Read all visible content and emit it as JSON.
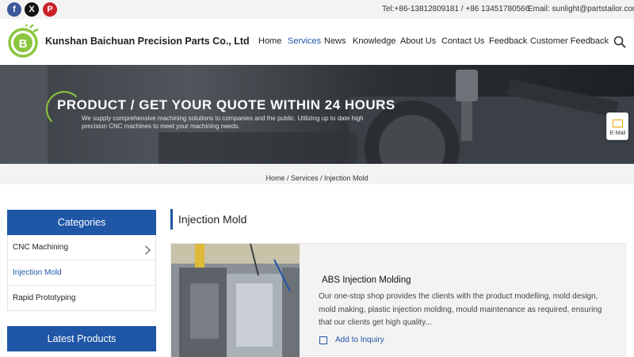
{
  "topbar": {
    "social": [
      {
        "name": "facebook",
        "glyph": "f"
      },
      {
        "name": "x-twitter",
        "glyph": "X"
      },
      {
        "name": "pinterest",
        "glyph": "P"
      }
    ],
    "tel": "Tel:+86-13812809181 / +86 13451780566",
    "email": "Email: sunlight@partstailor.com"
  },
  "header": {
    "company": "Kunshan Baichuan Precision Parts Co., Ltd",
    "logo_letter": "B",
    "nav": [
      "Home",
      "Services",
      "News",
      "Knowledge",
      "About Us",
      "Contact Us",
      "Feedback",
      "Customer Feedback"
    ],
    "active_nav": "Services"
  },
  "banner": {
    "title": "PRODUCT / GET YOUR QUOTE WITHIN 24 HOURS",
    "subtitle": "We supply comprehensive machining solutions to companies and the public. Utilizing up to date high precision CNC machines to meet your machining needs."
  },
  "email_widget": {
    "label": "E-Mail"
  },
  "breadcrumb": {
    "home": "Home",
    "sep": " / ",
    "services": "Services",
    "current": "Injection Mold"
  },
  "sidebar": {
    "categories_title": "Categories",
    "items": [
      {
        "label": "CNC Machining"
      },
      {
        "label": "Injection Mold"
      },
      {
        "label": "Rapid Prototyping"
      }
    ],
    "latest_title": "Latest Products"
  },
  "main": {
    "title": "Injection Mold",
    "product": {
      "title": "ABS Injection Molding",
      "description": "Our one-stop shop provides the clients with the product modelling, mold design, mold making, plastic injection molding, mould maintenance as required, ensuring that our clients get high quality...",
      "inquiry_label": "Add to Inquiry"
    }
  },
  "colors": {
    "brand": "#1f56a6",
    "logo_green": "#8cc63f",
    "accent_yellow": "#e6a400"
  }
}
